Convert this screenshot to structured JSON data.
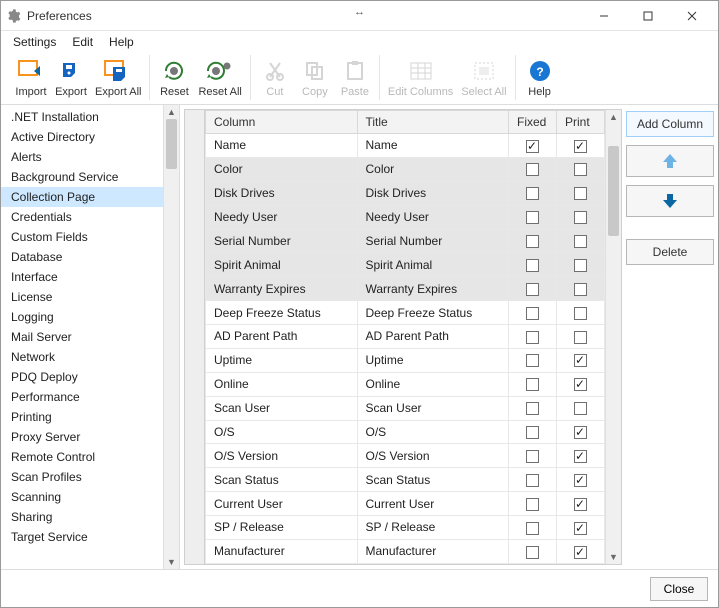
{
  "window": {
    "title": "Preferences"
  },
  "menu": {
    "settings": "Settings",
    "edit": "Edit",
    "help": "Help"
  },
  "toolbar": {
    "import": "Import",
    "export": "Export",
    "export_all": "Export All",
    "reset": "Reset",
    "reset_all": "Reset All",
    "cut": "Cut",
    "copy": "Copy",
    "paste": "Paste",
    "edit_columns": "Edit Columns",
    "select_all": "Select All",
    "help": "Help"
  },
  "sidebar": {
    "selected_index": 5,
    "items": [
      ".NET Installation",
      "Active Directory",
      "Alerts",
      "Background Service",
      "Collection Page",
      "Credentials",
      "Custom Fields",
      "Database",
      "Interface",
      "License",
      "Logging",
      "Mail Server",
      "Network",
      "PDQ Deploy",
      "Performance",
      "Printing",
      "Proxy Server",
      "Remote Control",
      "Scan Profiles",
      "Scanning",
      "Sharing",
      "Target Service"
    ]
  },
  "grid": {
    "headers": {
      "column": "Column",
      "title": "Title",
      "fixed": "Fixed",
      "print": "Print"
    },
    "selected_row_index": 1,
    "selection_end_index": 7,
    "rows": [
      {
        "column": "Name",
        "title": "Name",
        "fixed": true,
        "print": true
      },
      {
        "column": "Color",
        "title": "Color",
        "fixed": false,
        "print": false
      },
      {
        "column": "Disk Drives",
        "title": "Disk Drives",
        "fixed": false,
        "print": false
      },
      {
        "column": "Needy User",
        "title": "Needy User",
        "fixed": false,
        "print": false
      },
      {
        "column": "Serial Number",
        "title": "Serial Number",
        "fixed": false,
        "print": false
      },
      {
        "column": "Spirit Animal",
        "title": "Spirit Animal",
        "fixed": false,
        "print": false
      },
      {
        "column": "Warranty Expires",
        "title": "Warranty Expires",
        "fixed": false,
        "print": false
      },
      {
        "column": "Deep Freeze Status",
        "title": "Deep Freeze Status",
        "fixed": false,
        "print": false
      },
      {
        "column": "AD Parent Path",
        "title": "AD Parent Path",
        "fixed": false,
        "print": false
      },
      {
        "column": "Uptime",
        "title": "Uptime",
        "fixed": false,
        "print": true
      },
      {
        "column": "Online",
        "title": "Online",
        "fixed": false,
        "print": true
      },
      {
        "column": "Scan User",
        "title": "Scan User",
        "fixed": false,
        "print": false
      },
      {
        "column": "O/S",
        "title": "O/S",
        "fixed": false,
        "print": true
      },
      {
        "column": "O/S Version",
        "title": "O/S Version",
        "fixed": false,
        "print": true
      },
      {
        "column": "Scan Status",
        "title": "Scan Status",
        "fixed": false,
        "print": true
      },
      {
        "column": "Current User",
        "title": "Current User",
        "fixed": false,
        "print": true
      },
      {
        "column": "SP / Release",
        "title": "SP / Release",
        "fixed": false,
        "print": true
      },
      {
        "column": "Manufacturer",
        "title": "Manufacturer",
        "fixed": false,
        "print": true
      }
    ]
  },
  "right": {
    "add_column": "Add Column",
    "delete": "Delete"
  },
  "footer": {
    "close": "Close"
  }
}
